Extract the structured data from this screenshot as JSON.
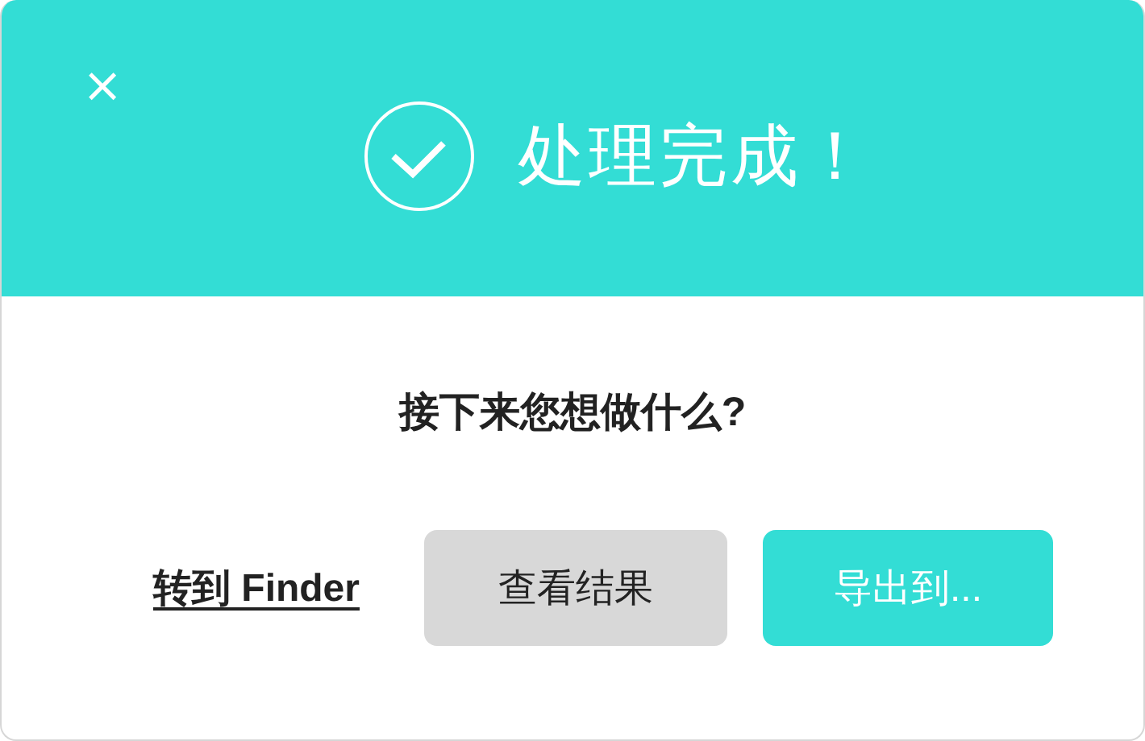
{
  "dialog": {
    "close": "×",
    "title": "处理完成！",
    "question": "接下来您想做什么?",
    "actions": [
      {
        "kind": "link",
        "label": "转到 Finder"
      },
      {
        "kind": "secondary",
        "label": "查看结果"
      },
      {
        "kind": "primary",
        "label": "导出到..."
      }
    ]
  }
}
